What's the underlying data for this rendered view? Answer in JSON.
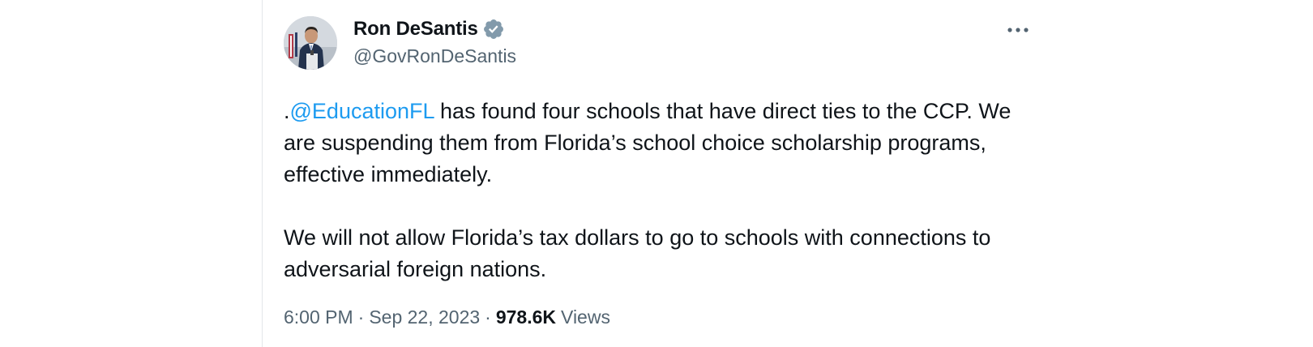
{
  "author": {
    "display_name": "Ron DeSantis",
    "handle": "@GovRonDeSantis",
    "verified_icon": "verified-badge-icon",
    "verified_color": "#829aab"
  },
  "more_icon": "more-horizontal-icon",
  "tweet": {
    "lead_punct": ".",
    "mention": "@EducationFL",
    "paragraph1_rest": " has found four schools that have direct ties to the CCP. We are suspending them from Florida’s school choice scholarship programs, effective immediately.",
    "paragraph2": "We will not allow Florida’s tax dollars to go to schools with connections to adversarial foreign nations."
  },
  "meta": {
    "time": "6:00 PM",
    "separator": "·",
    "date": "Sep 22, 2023",
    "views_count": "978.6K",
    "views_label": "Views"
  },
  "colors": {
    "text": "#0f1419",
    "secondary": "#536471",
    "link": "#1d9bf0",
    "divider": "#e3e7ea"
  }
}
